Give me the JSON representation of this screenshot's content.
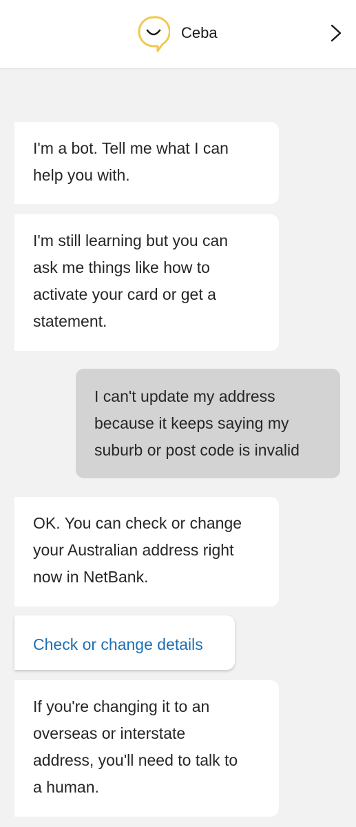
{
  "header": {
    "title": "Ceba",
    "logo_icon": "ceba-smile-speech-bubble-icon",
    "logo_color": "#f2c94c",
    "next_icon": "chevron-right-icon"
  },
  "messages": [
    {
      "sender": "bot",
      "lines": [
        "I'm a bot. Tell me what I can",
        "help you with."
      ]
    },
    {
      "sender": "bot",
      "lines": [
        "I'm still learning but you can",
        "ask me things like how to",
        "activate your card or get a",
        "statement."
      ]
    },
    {
      "sender": "user",
      "lines": [
        "I can't update my address",
        "because it keeps saying my",
        "suburb or post code is invalid"
      ]
    },
    {
      "sender": "bot",
      "lines": [
        "OK. You can check or change",
        "your Australian address right",
        "now in NetBank."
      ]
    },
    {
      "sender": "bot-action",
      "lines": [
        "Check or change details"
      ]
    },
    {
      "sender": "bot",
      "lines": [
        "If you're changing it to an",
        "overseas or interstate",
        "address, you'll need to talk to",
        "a human."
      ]
    }
  ],
  "colors": {
    "background": "#f2f2f2",
    "bot_bubble": "#ffffff",
    "user_bubble": "#d3d3d3",
    "link": "#1f6fb2"
  }
}
